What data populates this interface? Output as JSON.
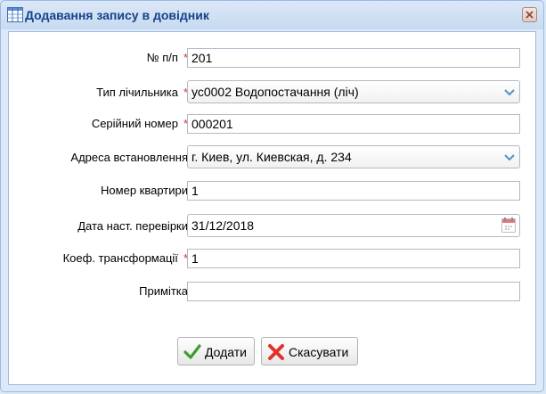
{
  "window": {
    "title": "Додавання запису в довідник"
  },
  "form": {
    "number": {
      "label": "№ п/п",
      "required": "*",
      "value": "201"
    },
    "meter_type": {
      "label": "Тип лічильника",
      "required": "*",
      "value": "ус0002 Водопостачання (ліч)"
    },
    "serial": {
      "label": "Серійний номер",
      "required": "*",
      "value": "000201"
    },
    "address": {
      "label": "Адреса встановлення",
      "value": "г. Киев, ул. Киевская, д. 234"
    },
    "apartment": {
      "label": "Номер квартири",
      "value": "1"
    },
    "next_check": {
      "label": "Дата наст. перевірки",
      "value": "31/12/2018"
    },
    "coef": {
      "label": "Коеф. трансформації",
      "required": "*",
      "value": "1"
    },
    "note": {
      "label": "Примітка",
      "value": ""
    }
  },
  "buttons": {
    "add": "Додати",
    "cancel": "Скасувати"
  },
  "icons": {
    "title": "grid-table-icon",
    "close": "close-icon",
    "dropdown": "chevron-down-icon",
    "calendar": "calendar-icon",
    "add": "check-icon",
    "cancel": "cross-icon"
  },
  "colors": {
    "title_text": "#15428b",
    "required": "#d32f2f",
    "border": "#99bbe8"
  }
}
